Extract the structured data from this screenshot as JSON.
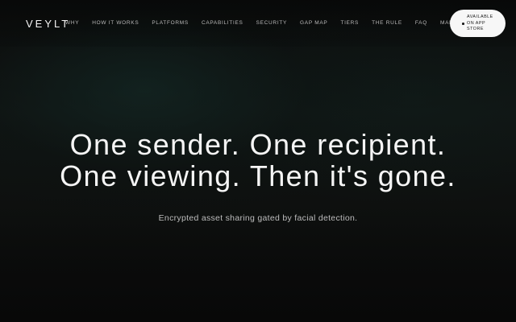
{
  "brand": {
    "logo": "VEYLT"
  },
  "nav": {
    "items": [
      "WHY",
      "HOW IT WORKS",
      "PLATFORMS",
      "CAPABILITIES",
      "SECURITY",
      "GAP MAP",
      "TIERS",
      "THE RULE",
      "FAQ",
      "MANIFESTO"
    ]
  },
  "cta": {
    "app_store_line1": "AVAILABLE",
    "app_store_line2": "ON APP",
    "app_store_line3": "STORE"
  },
  "hero": {
    "headline_line1": "One sender. One recipient.",
    "headline_line2": "One viewing. Then it's gone.",
    "subheadline": "Encrypted asset sharing gated by facial detection."
  },
  "colors": {
    "background": "#0b0b0b",
    "accent_glow": "#142e2a",
    "headline": "#f5f5f5",
    "button_bg": "#f7f7f7"
  }
}
